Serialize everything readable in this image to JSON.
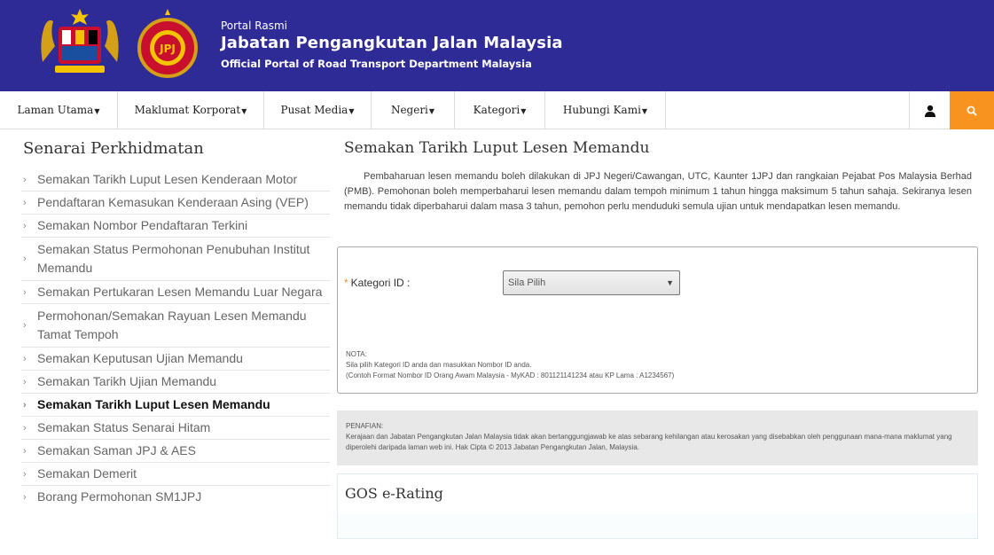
{
  "header": {
    "portal_small": "Portal Rasmi",
    "portal_title": "Jabatan Pengangkutan Jalan Malaysia",
    "portal_subtitle": "Official Portal of Road Transport Department Malaysia",
    "logo_left_icon": "malaysia-coat-of-arms-icon",
    "logo_right_icon": "jpj-emblem-icon",
    "logo_right_text": "JPJ",
    "colors": {
      "header_bg": "#2e2a96",
      "accent": "#f7931e"
    }
  },
  "nav": {
    "items": [
      {
        "label": "Laman Utama"
      },
      {
        "label": "Maklumat Korporat"
      },
      {
        "label": "Pusat Media"
      },
      {
        "label": "Negeri"
      },
      {
        "label": "Kategori"
      },
      {
        "label": "Hubungi Kami"
      }
    ],
    "user_icon": "user-icon",
    "search_icon": "search-icon"
  },
  "sidebar": {
    "title": "Senarai Perkhidmatan",
    "items": [
      {
        "label": "Semakan Tarikh Luput Lesen Kenderaan Motor",
        "active": false
      },
      {
        "label": "Pendaftaran Kemasukan Kenderaan Asing (VEP)",
        "active": false
      },
      {
        "label": "Semakan Nombor Pendaftaran Terkini",
        "active": false
      },
      {
        "label": "Semakan Status Permohonan Penubuhan Institut Memandu",
        "active": false
      },
      {
        "label": "Semakan Pertukaran Lesen Memandu Luar Negara",
        "active": false
      },
      {
        "label": "Permohonan/Semakan Rayuan Lesen Memandu Tamat Tempoh",
        "active": false
      },
      {
        "label": "Semakan Keputusan Ujian Memandu",
        "active": false
      },
      {
        "label": "Semakan Tarikh Ujian Memandu",
        "active": false
      },
      {
        "label": "Semakan Tarikh Luput Lesen Memandu",
        "active": true
      },
      {
        "label": "Semakan Status Senarai Hitam",
        "active": false
      },
      {
        "label": "Semakan Saman JPJ & AES",
        "active": false
      },
      {
        "label": "Semakan Demerit",
        "active": false
      },
      {
        "label": "Borang Permohonan SM1JPJ",
        "active": false
      }
    ]
  },
  "main": {
    "title": "Semakan Tarikh Luput Lesen Memandu",
    "intro": "Pembaharuan lesen memandu boleh dilakukan di JPJ Negeri/Cawangan, UTC, Kaunter 1JPJ dan rangkaian Pejabat Pos Malaysia Berhad (PMB). Pemohonan boleh memperbaharui lesen memandu dalam tempoh minimum 1 tahun hingga maksimum 5 tahun sahaja. Sekiranya lesen memandu tidak diperbaharui dalam masa 3 tahun, pemohon perlu menduduki semula ujian untuk mendapatkan lesen memandu.",
    "form": {
      "required_mark": "*",
      "kategori_label": "Kategori ID :",
      "kategori_selected": "Sila Pilih",
      "note_title": "NOTA:",
      "note_line1": "Sila pilih Kategori ID anda dan masukkan Nombor ID anda.",
      "note_line2": "(Contoh Format Nombor ID Orang Awam Malaysia - MyKAD : 801121141234 atau KP Lama : A1234567)"
    },
    "disclaimer": {
      "title": "PENAFIAN:",
      "text": "Kerajaan dan Jabatan Pengangkutan Jalan Malaysia tidak akan bertanggungjawab ke atas sebarang kehilangan atau kerosakan yang disebabkan oleh penggunaan mana-mana maklumat yang diperolehi daripada laman web ini. Hak Cipta © 2013 Jabatan Pengangkutan Jalan, Malaysia."
    },
    "rating": {
      "title": "GOS e-Rating"
    }
  }
}
